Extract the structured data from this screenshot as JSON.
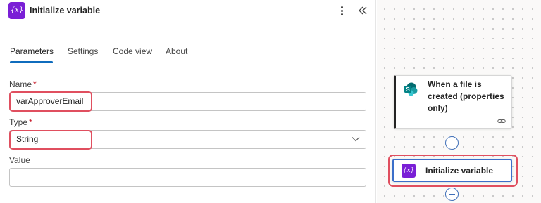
{
  "header": {
    "icon_text": "{x}",
    "title": "Initialize variable"
  },
  "tabs": [
    {
      "label": "Parameters",
      "active": true
    },
    {
      "label": "Settings",
      "active": false
    },
    {
      "label": "Code view",
      "active": false
    },
    {
      "label": "About",
      "active": false
    }
  ],
  "fields": {
    "name": {
      "label": "Name",
      "required_mark": "*",
      "value": "varApproverEmail"
    },
    "type": {
      "label": "Type",
      "required_mark": "*",
      "value": "String"
    },
    "value": {
      "label": "Value",
      "value": ""
    }
  },
  "flow": {
    "trigger": {
      "title": "When a file is created (properties only)",
      "icon": "sharepoint-icon"
    },
    "action": {
      "icon_text": "{x}",
      "title": "Initialize variable"
    }
  },
  "colors": {
    "variable_accent": "#7a1fd6",
    "tab_underline": "#0f6cbd",
    "highlight": "#e04f5f",
    "selected_border": "#3b6fc9",
    "sharepoint": "#038387"
  }
}
